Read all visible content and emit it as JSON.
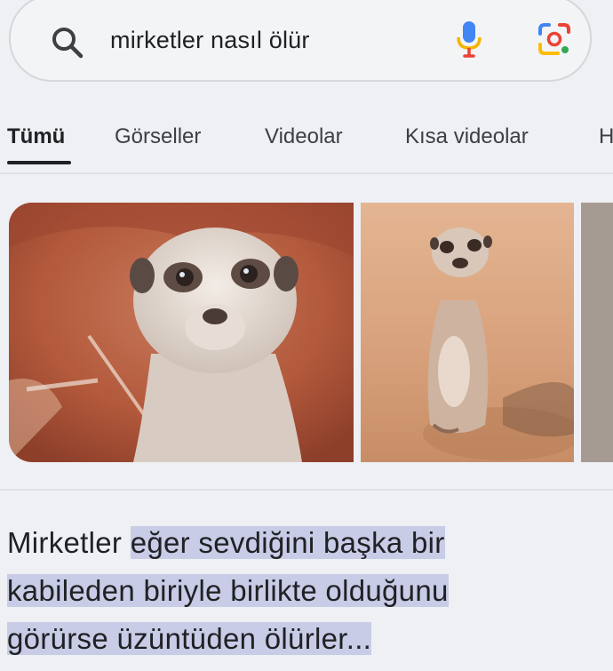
{
  "search": {
    "query": "mirketler nasıl ölür"
  },
  "tabs": [
    {
      "label": "Tümü",
      "active": true
    },
    {
      "label": "Görseller",
      "active": false
    },
    {
      "label": "Videolar",
      "active": false
    },
    {
      "label": "Kısa videolar",
      "active": false
    },
    {
      "label": "H",
      "active": false
    }
  ],
  "images": [
    {
      "subject": "meerkat-closeup"
    },
    {
      "subject": "meerkat-standing"
    },
    {
      "subject": "partial-image"
    }
  ],
  "snippet": {
    "lead": "Mirketler ",
    "line1": "eğer sevdiğini başka bir",
    "line2": "kabileden biriyle birlikte olduğunu",
    "line3": "görürse üzüntüden ölürler..."
  },
  "colors": {
    "highlight": "#c8cce6",
    "mic_blue": "#4285f4",
    "mic_stand": "#f4b400",
    "mic_base": "#ea4335",
    "lens_blue": "#4285f4",
    "lens_red": "#ea4335",
    "lens_yellow": "#fbbc04",
    "lens_green": "#34a853"
  }
}
